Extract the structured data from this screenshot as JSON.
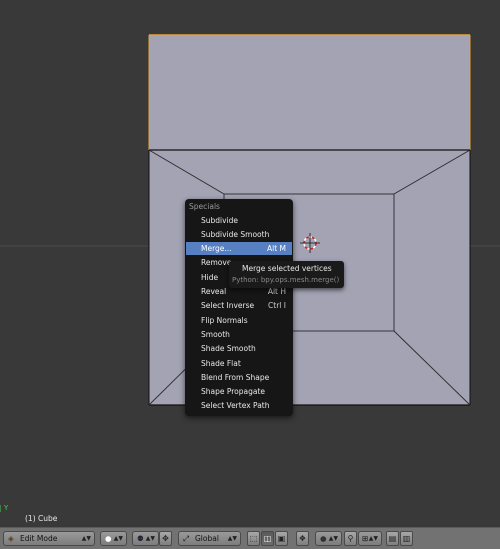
{
  "menu": {
    "title": "Specials",
    "items": [
      {
        "label": "Subdivide",
        "shortcut": ""
      },
      {
        "label": "Subdivide Smooth",
        "shortcut": ""
      },
      {
        "label": "Merge...",
        "shortcut": "Alt M"
      },
      {
        "label": "Remove",
        "shortcut": ""
      },
      {
        "label": "Hide",
        "shortcut": ""
      },
      {
        "label": "Reveal",
        "shortcut": "Alt H"
      },
      {
        "label": "Select Inverse",
        "shortcut": "Ctrl I"
      },
      {
        "label": "Flip Normals",
        "shortcut": ""
      },
      {
        "label": "Smooth",
        "shortcut": ""
      },
      {
        "label": "Shade Smooth",
        "shortcut": ""
      },
      {
        "label": "Shade Flat",
        "shortcut": ""
      },
      {
        "label": "Blend From Shape",
        "shortcut": ""
      },
      {
        "label": "Shape Propagate",
        "shortcut": ""
      },
      {
        "label": "Select Vertex Path",
        "shortcut": ""
      }
    ],
    "active_index": 2
  },
  "tooltip": {
    "title": "Merge selected vertices",
    "python": "Python: bpy.ops.mesh.merge()"
  },
  "viewport": {
    "object_label": "(1) Cube",
    "axis_y": "Y",
    "colors": {
      "background": "#393939",
      "mesh_face": "#a3a3b4",
      "edge": "#111111",
      "selected_edge": "#e8a23c",
      "menu_highlight": "#5680c2"
    }
  },
  "header": {
    "mode": "Edit Mode",
    "orientation": "Global",
    "icons": [
      "editor-type-icon",
      "mode-icon",
      "shading-sphere-icon",
      "pivot-icon",
      "manipulator-icon",
      "orientation-icon",
      "vertex-select-icon",
      "edge-select-icon",
      "face-select-icon",
      "proportional-edit-icon",
      "falloff-icon",
      "snap-icon",
      "render-icon",
      "camera-icon"
    ]
  }
}
